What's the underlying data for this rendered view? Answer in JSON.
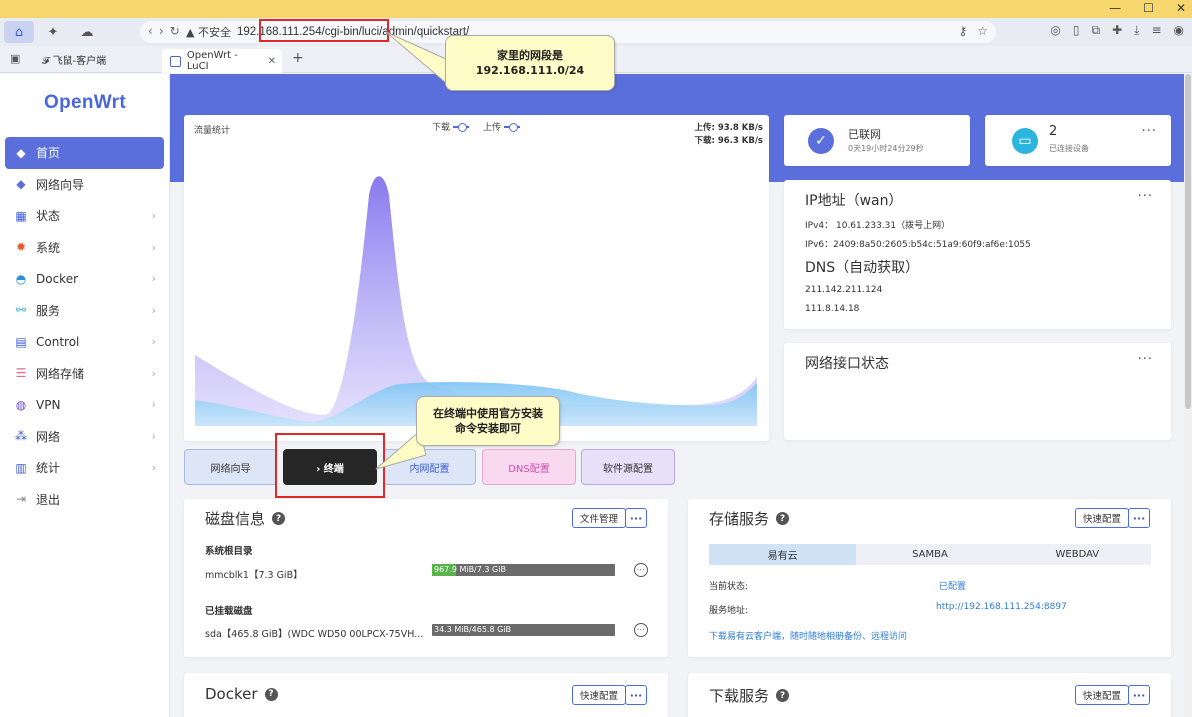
{
  "browser": {
    "security": "不安全",
    "url": "192.168.111.254/cgi-bin/luci/admin/quickstart/",
    "bookmark": "飞鼠-客户端",
    "tab_title": "OpenWrt - LuCI"
  },
  "sidebar": {
    "logo": "OpenWrt",
    "items": [
      {
        "label": "首页",
        "icon": "cube-icon",
        "active": true
      },
      {
        "label": "网络向导",
        "icon": "cube-icon"
      },
      {
        "label": "状态",
        "icon": "grid-icon"
      },
      {
        "label": "系统",
        "icon": "gear-icon"
      },
      {
        "label": "Docker",
        "icon": "docker-icon"
      },
      {
        "label": "服务",
        "icon": "share-icon"
      },
      {
        "label": "Control",
        "icon": "control-icon"
      },
      {
        "label": "网络存储",
        "icon": "database-icon"
      },
      {
        "label": "VPN",
        "icon": "globe-icon"
      },
      {
        "label": "网络",
        "icon": "network-icon"
      },
      {
        "label": "统计",
        "icon": "bar-chart-icon"
      },
      {
        "label": "退出",
        "icon": "logout-icon"
      }
    ]
  },
  "traffic": {
    "title": "流量统计",
    "legend_down": "下载",
    "legend_up": "上传",
    "upload_rate": "上传: 93.8 KB/s",
    "download_rate": "下载: 96.3 KB/s"
  },
  "quick_buttons": [
    "网络向导",
    "› 终端",
    "内网配置",
    "DNS配置",
    "软件源配置"
  ],
  "network_status": {
    "label": "已联网",
    "uptime": "0天19小时24分29秒"
  },
  "devices": {
    "count": "2",
    "label": "已连接设备"
  },
  "ip": {
    "title": "IP地址（wan）",
    "ipv4": "IPv4： 10.61.233.31（拨号上网）",
    "ipv6": "IPv6：2409:8a50:2605:b54c:51a9:60f9:af6e:1055",
    "dns_title": "DNS（自动获取）",
    "dns1": "211.142.211.124",
    "dns2": "111.8.14.18"
  },
  "interfaces": {
    "title": "网络接口状态"
  },
  "disk": {
    "title": "磁盘信息",
    "btn": "文件管理",
    "root_label": "系统根目录",
    "root_dev": "mmcblk1【7.3 GiB】",
    "root_usage": "967.9 MiB/7.3 GiB",
    "root_fraction": 0.13,
    "mounted_label": "已挂载磁盘",
    "mounted_dev": "sda【465.8 GiB】(WDC WD50 00LPCX-75VH...",
    "mounted_usage": "34.3 MiB/465.8 GiB",
    "mounted_fraction": 0.0
  },
  "storage": {
    "title": "存储服务",
    "btn": "快速配置",
    "tabs": [
      "易有云",
      "SAMBA",
      "WEBDAV"
    ],
    "status_label": "当前状态:",
    "status_value": "已配置",
    "addr_label": "服务地址:",
    "addr_value": "http://192.168.111.254:8897",
    "download_link": "下载易有云客户端，随时随地相册备份、远程访问"
  },
  "docker": {
    "title": "Docker",
    "btn": "快速配置"
  },
  "downloads": {
    "title": "下载服务",
    "btn": "快速配置"
  },
  "callouts": {
    "top": "家里的网段是\n192.168.111.0/24",
    "bottom": "在终端中使用官方安装\n命令安装即可"
  },
  "colors": {
    "accent": "#5b6fdc",
    "highlight": "#e02828",
    "callout_bg": "#fffcc8"
  }
}
